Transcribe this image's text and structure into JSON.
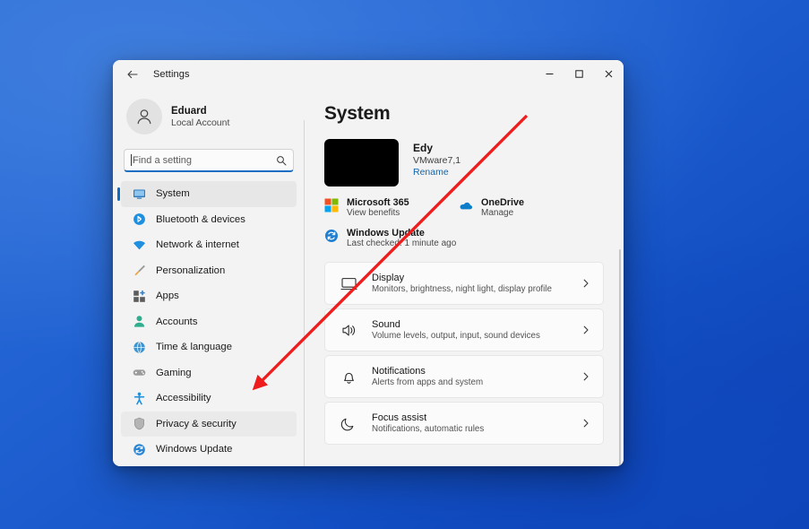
{
  "window": {
    "title": "Settings",
    "back_icon": "back-arrow-icon",
    "minimize_label": "─",
    "maximize_label": "□",
    "close_label": "✕"
  },
  "sidebar": {
    "account": {
      "name": "Eduard",
      "subtitle": "Local Account",
      "avatar_icon": "person-icon"
    },
    "search": {
      "placeholder": "Find a setting",
      "value": "",
      "icon": "search-icon"
    },
    "items": [
      {
        "label": "System",
        "icon": "monitor-icon",
        "selected": true,
        "color": "#1f6fb7"
      },
      {
        "label": "Bluetooth & devices",
        "icon": "bluetooth-icon",
        "selected": false,
        "color": "#1f8fe0"
      },
      {
        "label": "Network & internet",
        "icon": "wifi-icon",
        "selected": false,
        "color": "#1f8fe0"
      },
      {
        "label": "Personalization",
        "icon": "paintbrush-icon",
        "selected": false,
        "color": "#d79a3a"
      },
      {
        "label": "Apps",
        "icon": "apps-icon",
        "selected": false,
        "color": "#4a4a4a"
      },
      {
        "label": "Accounts",
        "icon": "accounts-icon",
        "selected": false,
        "color": "#2fae8f"
      },
      {
        "label": "Time & language",
        "icon": "clock-globe-icon",
        "selected": false,
        "color": "#2d84c8"
      },
      {
        "label": "Gaming",
        "icon": "gamepad-icon",
        "selected": false,
        "color": "#8b8b8b"
      },
      {
        "label": "Accessibility",
        "icon": "accessibility-icon",
        "selected": false,
        "color": "#1f8fe0"
      },
      {
        "label": "Privacy & security",
        "icon": "shield-icon",
        "selected": false,
        "color": "#9a9a9a",
        "highlighted": true,
        "hovered": true
      },
      {
        "label": "Windows Update",
        "icon": "update-icon",
        "selected": false,
        "color": "#1f7fd0"
      }
    ]
  },
  "main": {
    "page_title": "System",
    "device": {
      "name": "Edy",
      "model": "VMware7,1",
      "rename_label": "Rename"
    },
    "quick_links": [
      {
        "title": "Microsoft 365",
        "subtitle": "View benefits",
        "icon": "microsoft-logo-icon"
      },
      {
        "title": "OneDrive",
        "subtitle": "Manage",
        "icon": "onedrive-cloud-icon"
      },
      {
        "title": "Windows Update",
        "subtitle": "Last checked: 1 minute ago",
        "icon": "update-icon"
      }
    ],
    "cards": [
      {
        "title": "Display",
        "subtitle": "Monitors, brightness, night light, display profile",
        "icon": "display-icon",
        "chevron": "chevron-right-icon"
      },
      {
        "title": "Sound",
        "subtitle": "Volume levels, output, input, sound devices",
        "icon": "speaker-icon",
        "chevron": "chevron-right-icon"
      },
      {
        "title": "Notifications",
        "subtitle": "Alerts from apps and system",
        "icon": "bell-icon",
        "chevron": "chevron-right-icon"
      },
      {
        "title": "Focus assist",
        "subtitle": "Notifications, automatic rules",
        "icon": "moon-icon",
        "chevron": "chevron-right-icon"
      }
    ]
  },
  "annotations": {
    "arrow_color": "#ee1c1c",
    "highlight_box_color": "#ec1c22",
    "click_halo_color": "#7ae2ee"
  }
}
